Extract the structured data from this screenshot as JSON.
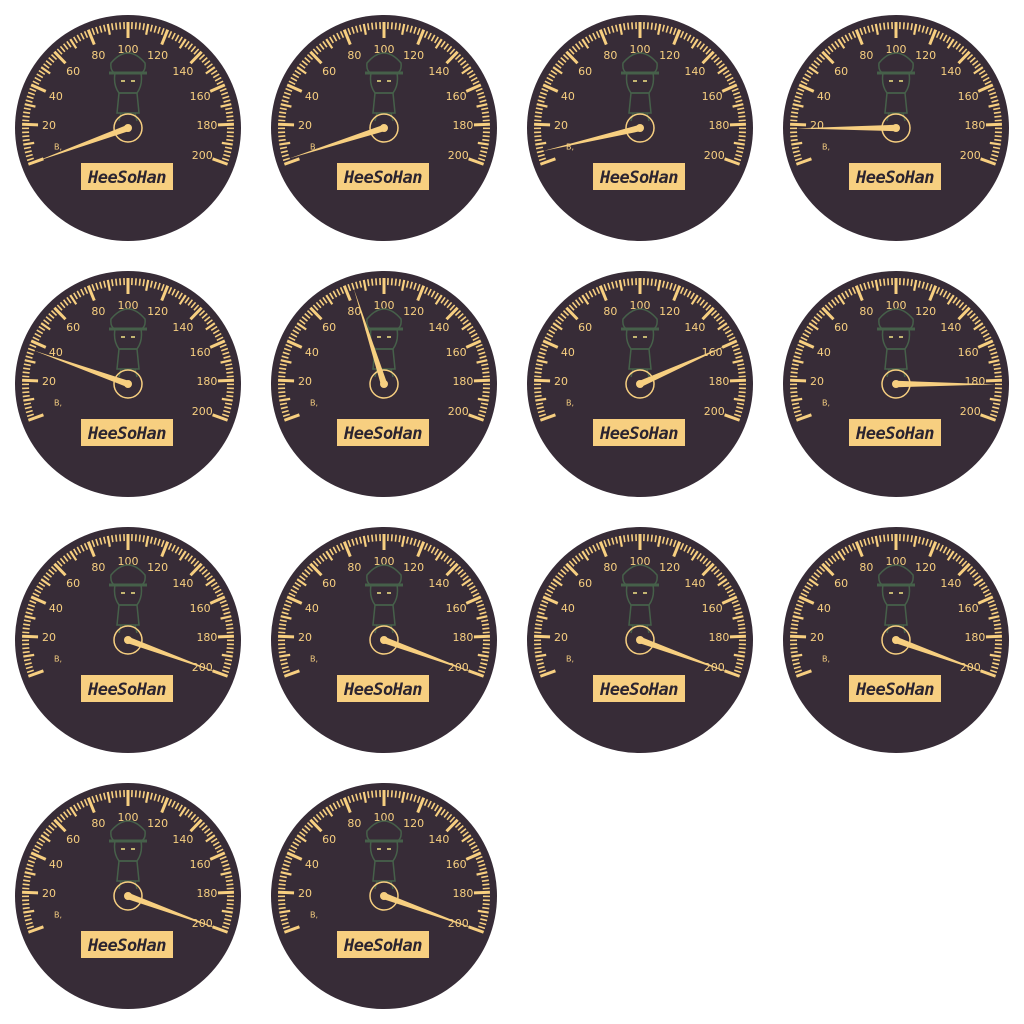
{
  "sprite_sheet": {
    "columns": 4,
    "gauge": {
      "scale_min": 0,
      "scale_max": 200,
      "scale_start_deg": 200,
      "scale_end_deg": -20,
      "major_labels": [
        "20",
        "40",
        "60",
        "80",
        "100",
        "120",
        "140",
        "160",
        "180",
        "200"
      ],
      "unit_label": "B,",
      "brand_label": "HeeSoHan",
      "character_icon": "chibi-character-in-cap-icon",
      "colors": {
        "face": "#372c37",
        "accent": "#f7cf80",
        "character": "#46604a"
      }
    },
    "frames": [
      {
        "frame": "1",
        "needle_value": 0
      },
      {
        "frame": "2",
        "needle_value": 2
      },
      {
        "frame": "3",
        "needle_value": 6
      },
      {
        "frame": "4",
        "needle_value": 18
      },
      {
        "frame": "5",
        "needle_value": 36
      },
      {
        "frame": "6",
        "needle_value": 84
      },
      {
        "frame": "7",
        "needle_value": 160
      },
      {
        "frame": "8",
        "needle_value": 182
      },
      {
        "frame": "9",
        "needle_value": 200
      },
      {
        "frame": "10",
        "needle_value": 200
      },
      {
        "frame": "11",
        "needle_value": 200
      },
      {
        "frame": "12",
        "needle_value": 200
      },
      {
        "frame": "13",
        "needle_value": 200
      },
      {
        "frame": "14",
        "needle_value": 200
      }
    ]
  }
}
